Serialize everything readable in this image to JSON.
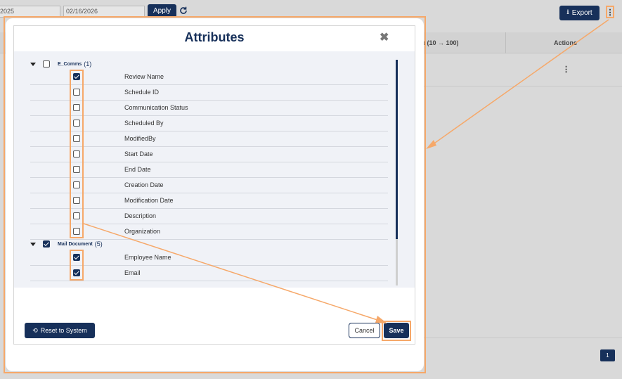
{
  "toolbar": {
    "start_date": "2025",
    "end_date": "02/16/2026",
    "apply_label": "Apply",
    "export_label": "Export"
  },
  "table": {
    "score_header": "e (10 → 100)",
    "actions_header": "Actions"
  },
  "pagination": {
    "current_page": "1"
  },
  "modal": {
    "title": "Attributes",
    "groups": [
      {
        "label": "E_Comms",
        "count": "(1)",
        "checked": false,
        "items": [
          {
            "label": "Review Name",
            "checked": true
          },
          {
            "label": "Schedule ID",
            "checked": false
          },
          {
            "label": "Communication Status",
            "checked": false
          },
          {
            "label": "Scheduled By",
            "checked": false
          },
          {
            "label": "ModifiedBy",
            "checked": false
          },
          {
            "label": "Start Date",
            "checked": false
          },
          {
            "label": "End Date",
            "checked": false
          },
          {
            "label": "Creation Date",
            "checked": false
          },
          {
            "label": "Modification Date",
            "checked": false
          },
          {
            "label": "Description",
            "checked": false
          },
          {
            "label": "Organization",
            "checked": false
          }
        ]
      },
      {
        "label": "Mail Document",
        "count": "(5)",
        "checked": true,
        "items": [
          {
            "label": "Employee Name",
            "checked": true
          },
          {
            "label": "Email",
            "checked": true
          }
        ]
      }
    ],
    "reset_label": "Reset to System",
    "cancel_label": "Cancel",
    "save_label": "Save"
  },
  "colors": {
    "primary": "#17305a",
    "highlight": "#f6a869"
  }
}
